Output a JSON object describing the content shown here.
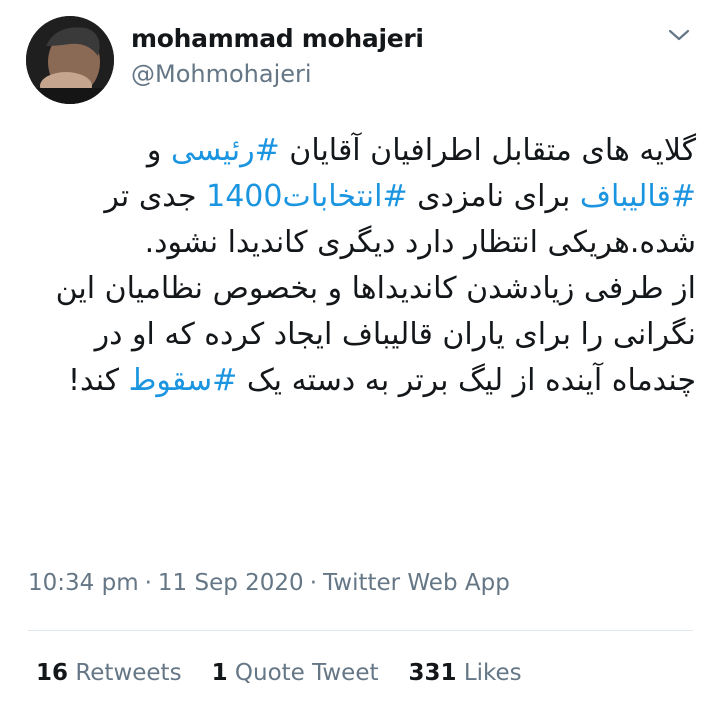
{
  "author": {
    "display_name": "mohammad mohajeri",
    "handle": "@Mohmohajeri",
    "avatar_icon": "profile-photo"
  },
  "menu_icon": "chevron-down-icon",
  "tweet": {
    "para1": {
      "t1": "گلایه های متقابل اطرافیان آقایان ",
      "h1": "#رئیسی",
      "t2": " و ",
      "h2": "#قالیباف",
      "t3": " برای نامزدی ",
      "h3": "#انتخابات1400",
      "t4": " جدی تر شده.هریکی انتظار دارد دیگری کاندیدا نشود."
    },
    "para2": {
      "t1": "از طرفی زیادشدن کاندیداها و بخصوص نظامیان این نگرانی را برای یاران قالیباف ایجاد کرده که او در چندماه آینده از لیگ برتر به دسته یک ",
      "h1": "#سقوط",
      "t2": " کند!"
    }
  },
  "meta": {
    "time": "10:34 pm",
    "date": "11 Sep 2020",
    "source": "Twitter Web App",
    "separator": "·"
  },
  "stats": {
    "retweets_count": "16",
    "retweets_label": "Retweets",
    "quotes_count": "1",
    "quotes_label": "Quote Tweet",
    "likes_count": "331",
    "likes_label": "Likes"
  },
  "colors": {
    "link": "#1b95e0",
    "secondary_text": "#657786",
    "primary_text": "#14171a",
    "divider": "#e1e8ed"
  }
}
